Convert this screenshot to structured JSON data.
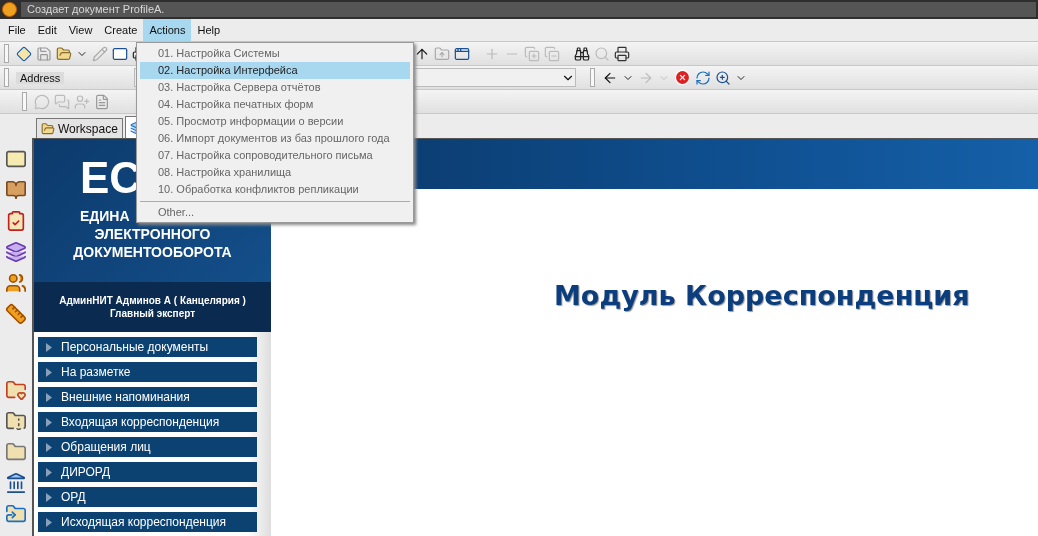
{
  "window": {
    "title": "Создает документ ProfileA."
  },
  "menu_bar": [
    {
      "label": "File",
      "selected": false
    },
    {
      "label": "Edit",
      "selected": false
    },
    {
      "label": "View",
      "selected": false
    },
    {
      "label": "Create",
      "selected": false
    },
    {
      "label": "Actions",
      "selected": true
    },
    {
      "label": "Help",
      "selected": false
    }
  ],
  "actions_menu": {
    "items": [
      {
        "label": "01. Настройка Системы",
        "selected": false
      },
      {
        "label": "02. Настройка Интерфейса",
        "selected": true
      },
      {
        "label": "03. Настройка Сервера отчётов",
        "selected": false
      },
      {
        "label": "04. Настройка печатных форм",
        "selected": false
      },
      {
        "label": "05. Просмотр информации о версии",
        "selected": false
      },
      {
        "label": "06. Импорт документов из баз прошлого года",
        "selected": false
      },
      {
        "label": "07. Настройка сопроводительного письма",
        "selected": false
      },
      {
        "label": "08. Настройка хранилища",
        "selected": false
      },
      {
        "label": "10. Обработка конфликтов репликации",
        "selected": false
      }
    ],
    "other": "Other..."
  },
  "address_bar": {
    "label": "Address"
  },
  "tabs": [
    {
      "kind": "text",
      "label": "Workspace",
      "selected": false
    },
    {
      "kind": "icon",
      "selected": true
    }
  ],
  "sidebar": {
    "logo_lines": [
      "ЕС",
      "ЕДИНА",
      "ЭЛЕКТРОННОГО",
      "ДОКУМЕНТООБОРОТА"
    ],
    "user": "АдминНИТ Админов А ( Канцелярия )",
    "position": "Главный эксперт",
    "items": [
      "Персональные документы",
      "На разметке",
      "Внешние напоминания",
      "Входящая корреспонденция",
      "Обращения лиц",
      "ДИРОРД",
      "ОРД",
      "Исходящая корреспонденция"
    ]
  },
  "content": {
    "title": "Модуль Корреспонденция"
  }
}
